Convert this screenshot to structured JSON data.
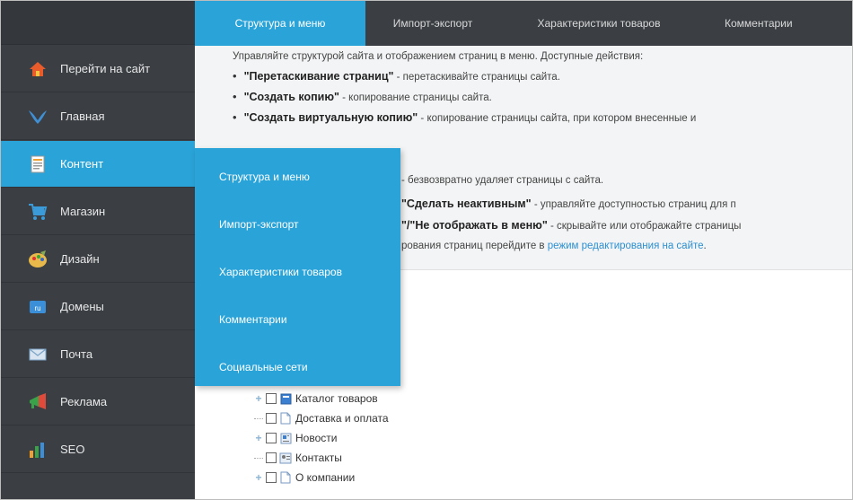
{
  "sidebar": {
    "items": [
      {
        "label": "Перейти на сайт",
        "icon": "home-icon"
      },
      {
        "label": "Главная",
        "icon": "bird-icon"
      },
      {
        "label": "Контент",
        "icon": "document-icon"
      },
      {
        "label": "Магазин",
        "icon": "cart-icon"
      },
      {
        "label": "Дизайн",
        "icon": "palette-icon"
      },
      {
        "label": "Домены",
        "icon": "domain-icon"
      },
      {
        "label": "Почта",
        "icon": "mail-icon"
      },
      {
        "label": "Реклама",
        "icon": "megaphone-icon"
      },
      {
        "label": "SEO",
        "icon": "bar-chart-icon"
      }
    ],
    "active_index": 2
  },
  "tabs": [
    {
      "label": "Структура и меню",
      "active": true
    },
    {
      "label": "Импорт-экспорт",
      "active": false
    },
    {
      "label": "Характеристики товаров",
      "active": false
    },
    {
      "label": "Комментарии",
      "active": false
    }
  ],
  "info": {
    "intro": "Управляйте структурой сайта и отображением страниц в меню. Доступные действия:",
    "b1_bold": "\"Перетаскивание страниц\"",
    "b1_text": " - перетаскивайте страницы сайта.",
    "b2_bold": "\"Создать копию\"",
    "b2_text": " - копирование страницы сайта.",
    "b3_bold": "\"Создать виртуальную копию\"",
    "b3_text": " - копирование страницы сайта, при котором внесенные и",
    "b4_text": " - безвозвратно удаляет страницы с сайта.",
    "b5_bold": "\"Сделать неактивным\"",
    "b5_text": " - управляйте доступностью страниц для п",
    "b6_bold": "\"/\"Не отображать в меню\"",
    "b6_text": " - скрывайте или отображайте страницы",
    "b7_text": "рования страниц перейдите в ",
    "b7_link": "режим редактирования на сайте",
    "b7_end": "."
  },
  "dropdown": {
    "items": [
      "Структура и меню",
      "Импорт-экспорт",
      "Характеристики товаров",
      "Комментарии",
      "Социальные сети"
    ]
  },
  "tree": [
    {
      "label": "Каталог товаров",
      "expandable": true,
      "icon": "catalog-icon"
    },
    {
      "label": "Доставка и оплата",
      "expandable": false,
      "icon": "page-icon"
    },
    {
      "label": "Новости",
      "expandable": true,
      "icon": "news-icon"
    },
    {
      "label": "Контакты",
      "expandable": false,
      "icon": "contacts-icon"
    },
    {
      "label": "О компании",
      "expandable": true,
      "icon": "page-icon"
    }
  ],
  "colors": {
    "sidebar_bg": "#3b3f44",
    "accent": "#2aa3d8",
    "link": "#2c8fd0"
  }
}
